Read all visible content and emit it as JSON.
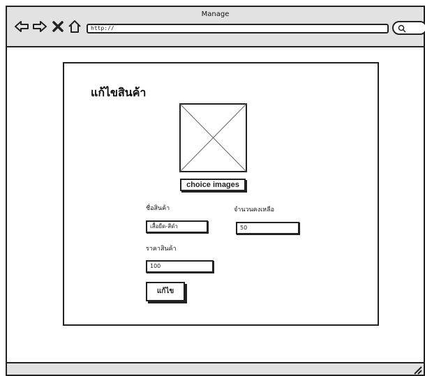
{
  "window": {
    "title": "Manage"
  },
  "browser": {
    "url": "http://",
    "icons": [
      "back-arrow-icon",
      "forward-arrow-icon",
      "close-icon",
      "home-icon",
      "search-icon"
    ]
  },
  "form": {
    "title": "แก้ไขสินค้า",
    "choice_images_label": "choice images",
    "fields": {
      "name": {
        "label": "ชื่อสินค้า",
        "value": "เสื้อยืด-สีดำ"
      },
      "stock": {
        "label": "จำนวนคงเหลือ",
        "value": "50"
      },
      "price": {
        "label": "ราคาสินค้า",
        "value": "100"
      }
    },
    "submit_label": "แก้ไข"
  }
}
